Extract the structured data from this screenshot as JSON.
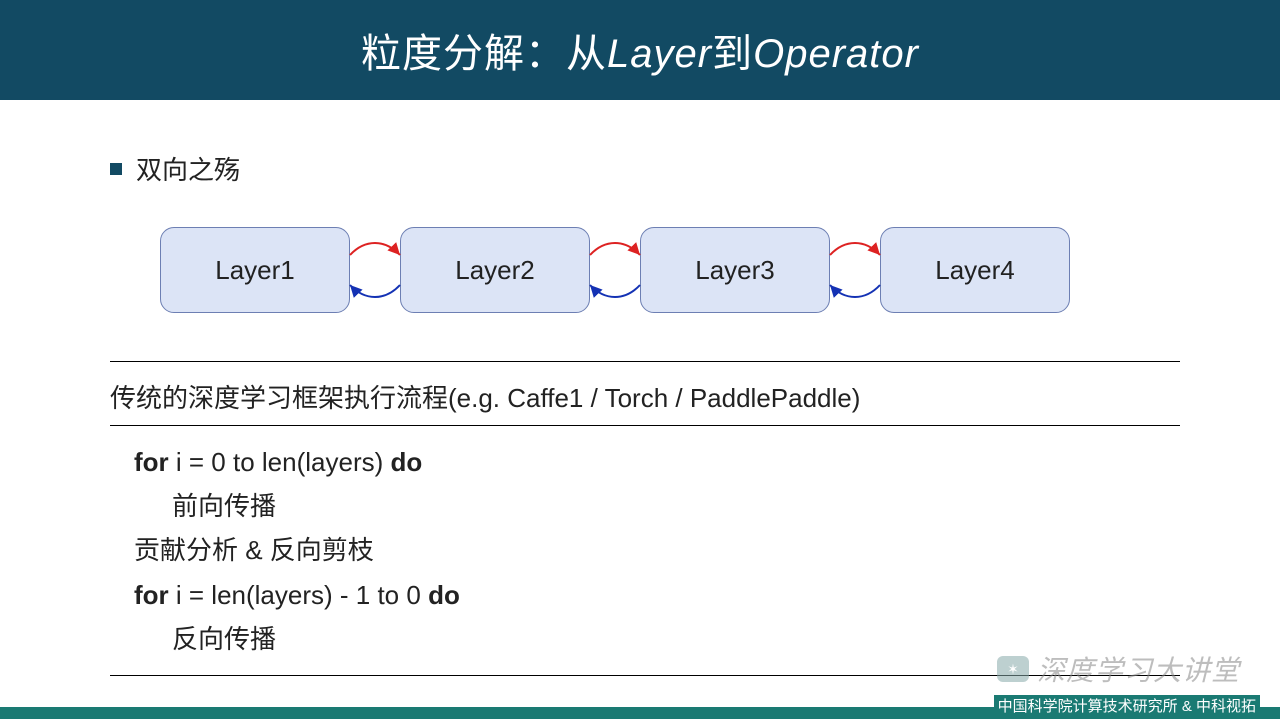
{
  "title": {
    "pre": "粒度分解：从",
    "mid1": "Layer",
    "mid2": "到",
    "suf": "Operator"
  },
  "bullet": "双向之殇",
  "layers": {
    "l1": "Layer1",
    "l2": "Layer2",
    "l3": "Layer3",
    "l4": "Layer4"
  },
  "algo_title": "传统的深度学习框架执行流程(e.g. Caffe1 / Torch / PaddlePaddle)",
  "algo": {
    "for1a": "for",
    "for1b": " i = 0 to len(layers) ",
    "for1c": "do",
    "fwd": "前向传播",
    "mid": "贡献分析 & 反向剪枝",
    "for2a": "for",
    "for2b": " i = len(layers) - 1 to 0 ",
    "for2c": "do",
    "bwd": "反向传播"
  },
  "watermark": "深度学习大讲堂",
  "footer": "中国科学院计算技术研究所 & 中科视拓"
}
